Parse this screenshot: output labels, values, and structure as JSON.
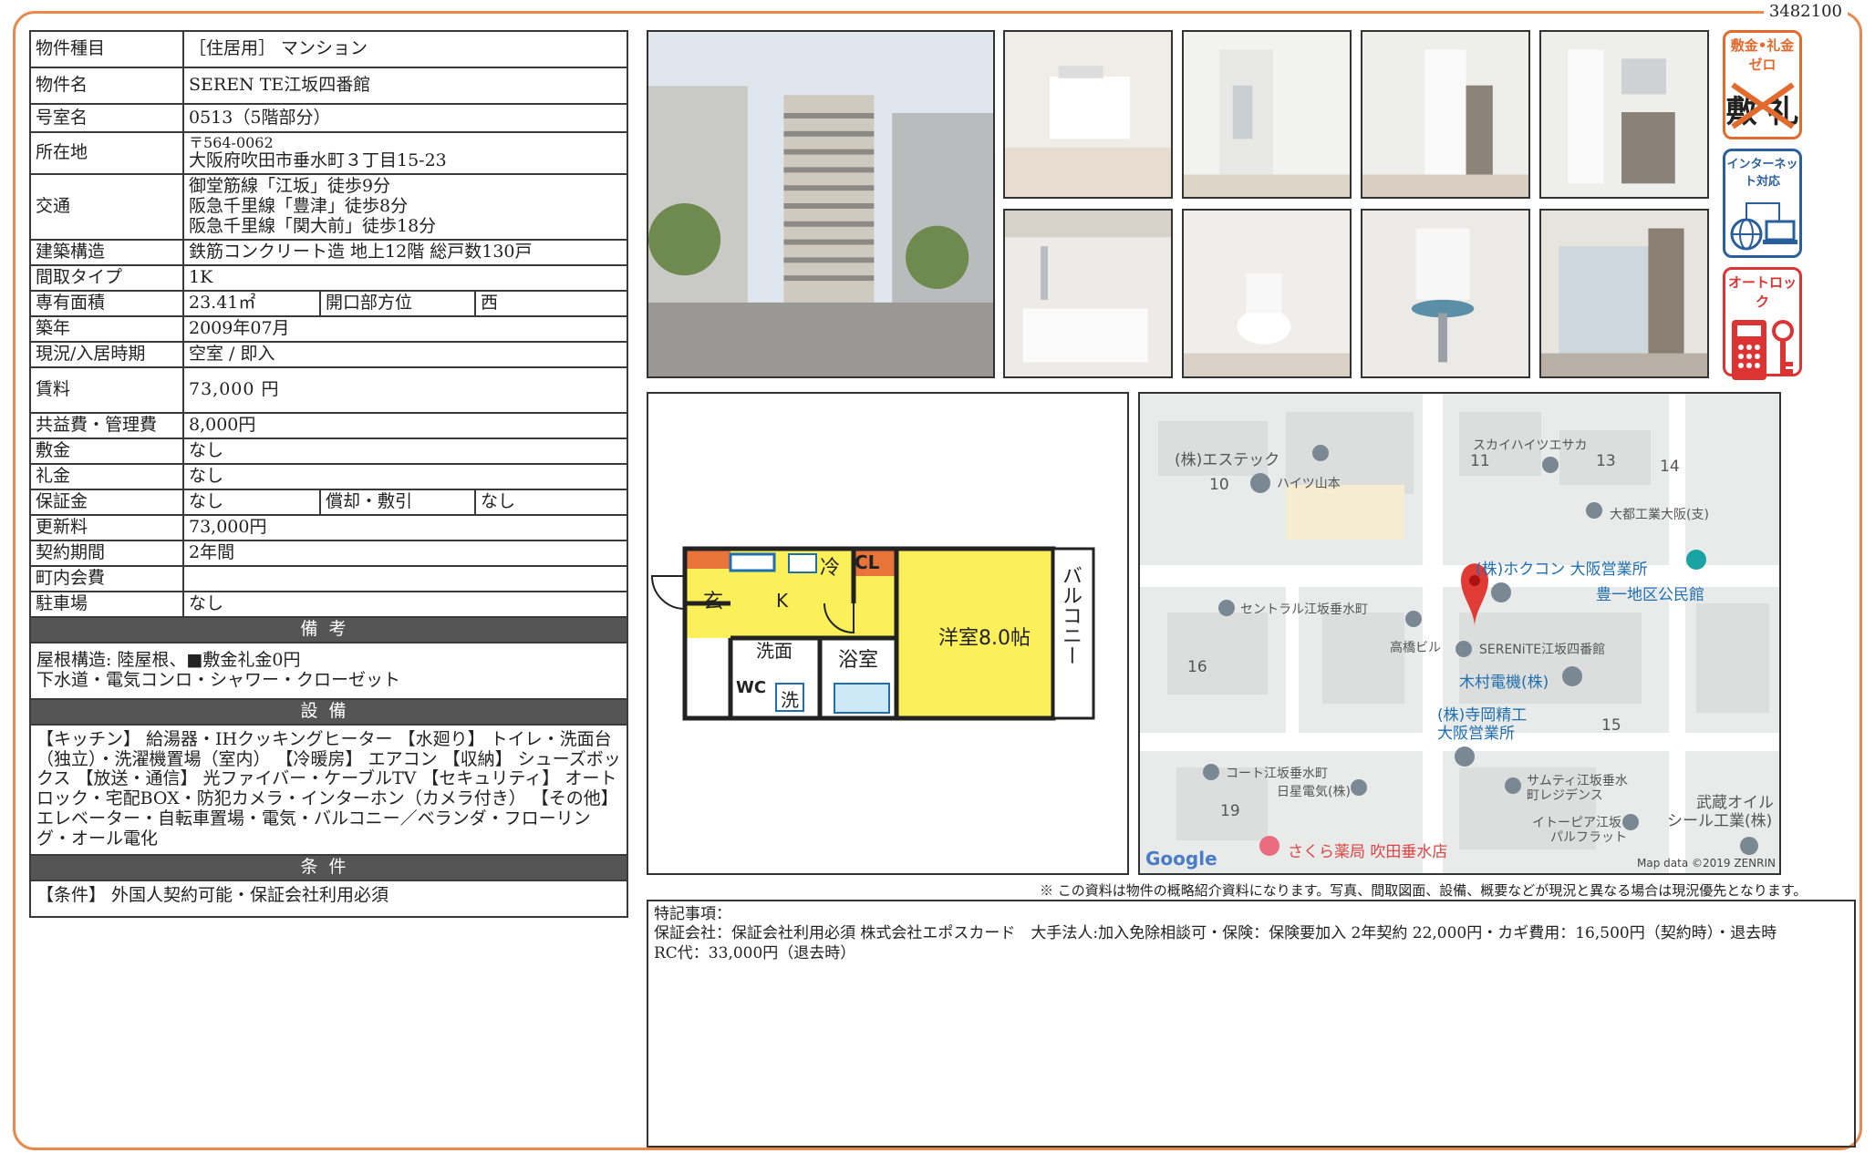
{
  "doc_id": "3482100",
  "info": {
    "type_label": "物件種目",
    "type_value": "［住居用］ マンション",
    "name_label": "物件名",
    "name_value": "SEREN TE江坂四番館",
    "room_label": "号室名",
    "room_value": "0513（5階部分）",
    "address_label": "所在地",
    "postal": "〒564-0062",
    "address_value": "大阪府吹田市垂水町３丁目15-23",
    "traffic_label": "交通",
    "traffic_lines": [
      "御堂筋線「江坂」徒歩9分",
      "阪急千里線「豊津」徒歩8分",
      "阪急千里線「関大前」徒歩18分"
    ],
    "structure_label": "建築構造",
    "structure_value": "鉄筋コンクリート造 地上12階 総戸数130戸",
    "layout_label": "間取タイプ",
    "layout_value": "1K",
    "area_label": "専有面積",
    "area_value": "23.41㎡",
    "direction_label": "開口部方位",
    "direction_value": "西",
    "built_label": "築年",
    "built_value": "2009年07月",
    "status_label": "現況/入居時期",
    "status_value": "空室 / 即入",
    "rent_label": "賃料",
    "rent_value": "73,000 円",
    "fee_label": "共益費・管理費",
    "fee_value": "8,000円",
    "deposit_label": "敷金",
    "deposit_value": "なし",
    "keymoney_label": "礼金",
    "keymoney_value": "なし",
    "guarantee_label": "保証金",
    "guarantee_value": "なし",
    "amort_label": "償却・敷引",
    "amort_value": "なし",
    "renew_label": "更新料",
    "renew_value": "73,000円",
    "contract_label": "契約期間",
    "contract_value": "2年間",
    "town_label": "町内会費",
    "town_value": "",
    "parking_label": "駐車場",
    "parking_value": "なし"
  },
  "remarks": {
    "title": "備考",
    "lines": [
      "屋根構造: 陸屋根、■敷金礼金0円",
      "下水道・電気コンロ・シャワー・クローゼット"
    ]
  },
  "facilities": {
    "title": "設備",
    "text": "【キッチン】 給湯器・IHクッキングヒーター 【水廻り】 トイレ・洗面台（独立）・洗濯機置場（室内） 【冷暖房】 エアコン 【収納】 シューズボックス 【放送・通信】 光ファイバー・ケーブルTV 【セキュリティ】 オートロック・宅配BOX・防犯カメラ・インターホン（カメラ付き） 【その他】 エレベーター・自転車置場・電気・バルコニー／ベランダ・フローリング・オール電化"
  },
  "conditions": {
    "title": "条件",
    "text": "【条件】 外国人契約可能・保証会社利用必須"
  },
  "badges": {
    "zero": "敷金•礼金ゼロ",
    "zero_cross": "敷 礼",
    "internet": "インターネット対応",
    "autolock": "オートロック"
  },
  "floorplan": {
    "genkan": "玄",
    "kitchen": "K",
    "fridge": "冷",
    "closet": "CL",
    "wash": "洗面",
    "bath": "浴室",
    "wc": "WC",
    "laundry": "洗",
    "room": "洋室8.0帖",
    "balcony": "バルコニー"
  },
  "map": {
    "labels": {
      "l1": "(株)エステック",
      "l2": "ハイツ山本",
      "l3": "スカイハイツエサカ",
      "l4": "大都工業大阪(支)",
      "l5": "(株)ホクコン 大阪営業所",
      "l6": "豊一地区公民館",
      "l7": "セントラル江坂垂水町",
      "l8": "高橋ビル",
      "l9": "SERENiTE江坂四番館",
      "l10": "木村電機(株)",
      "l11": "(株)寺岡精工",
      "l12": "大阪営業所",
      "l13": "コート江坂垂水町",
      "l14": "日星電気(株)",
      "l15": "サムティ江坂垂水",
      "l16": "町レジデンス",
      "l17": "イトーピア江坂",
      "l18": "パルフラット",
      "l19": "武蔵オイル",
      "l20": "シール工業(株)",
      "l21": "さくら薬局 吹田垂水店"
    },
    "numbers": {
      "n10": "10",
      "n11": "11",
      "n13": "13",
      "n14": "14",
      "n15": "15",
      "n16": "16",
      "n19": "19"
    },
    "google": "Google",
    "copyright": "Map data ©2019 ZENRIN"
  },
  "disclaimer": "※ この資料は物件の概略紹介資料になります。写真、間取図面、設備、概要などが現況と異なる場合は現況優先となります。",
  "special": {
    "title": "特記事項：",
    "line1": "保証会社：保証会社利用必須 株式会社エポスカード　大手法人:加入免除相談可・保険：保険要加入 2年契約 22,000円・カギ費用：16,500円（契約時）・退去時",
    "line2": "RC代：33,000円（退去時）"
  }
}
